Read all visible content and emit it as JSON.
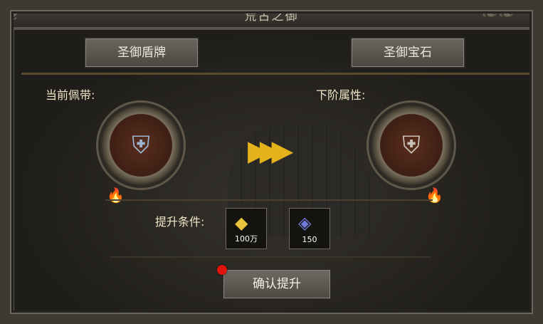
{
  "window": {
    "title": "荒古之御"
  },
  "tabs": [
    {
      "label": "圣御盾牌"
    },
    {
      "label": "圣御宝石"
    }
  ],
  "panels": {
    "current_label": "当前佩带:",
    "next_label": "下阶属性:",
    "current_item_icon": "shield-icon",
    "next_item_icon": "shield-icon"
  },
  "conditions": {
    "label": "提升条件:",
    "items": [
      {
        "icon": "gold-ingot-icon",
        "count": "100万"
      },
      {
        "icon": "gem-icon",
        "count": "150"
      }
    ]
  },
  "actions": {
    "confirm_label": "确认提升"
  },
  "colors": {
    "arrow": "#e4b21a",
    "notify_dot": "#e0140e"
  }
}
